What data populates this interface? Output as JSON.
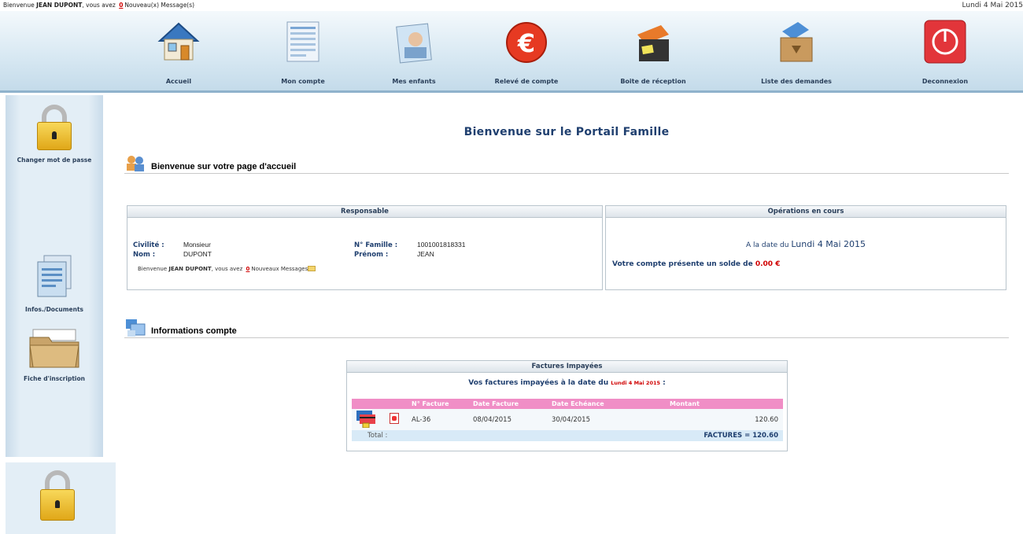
{
  "header": {
    "greeting_prefix": "Bienvenue",
    "user_name": "JEAN DUPONT",
    "greeting_mid": ", vous avez",
    "message_count": "0",
    "greeting_suffix": "Nouveau(x) Message(s)",
    "date": "Lundi 4 Mai 2015"
  },
  "nav": {
    "items": [
      {
        "label": "Accueil",
        "icon": "house-icon"
      },
      {
        "label": "Mon compte",
        "icon": "account-document-icon"
      },
      {
        "label": "Mes enfants",
        "icon": "children-photo-icon"
      },
      {
        "label": "Relevé de compte",
        "icon": "euro-icon"
      },
      {
        "label": "Boite de réception",
        "icon": "inbox-icon"
      },
      {
        "label": "Liste des demandes",
        "icon": "requests-box-icon"
      },
      {
        "label": "Deconnexion",
        "icon": "power-icon"
      }
    ]
  },
  "sidebar": {
    "items": [
      {
        "label": "Changer mot de passe",
        "icon": "lock-icon"
      },
      {
        "label": "Infos./Documents",
        "icon": "documents-icon"
      },
      {
        "label": "Fiche d'inscription",
        "icon": "folder-icon"
      }
    ]
  },
  "main": {
    "title": "Bienvenue sur le Portail Famille",
    "welcome_section": "Bienvenue sur votre page d'accueil",
    "account_section": "Informations compte"
  },
  "responsable": {
    "title": "Responsable",
    "civilite_label": "Civilité :",
    "civilite_value": "Monsieur",
    "nom_label": "Nom :",
    "nom_value": "DUPONT",
    "famille_label": "N° Famille :",
    "famille_value": "1001001818331",
    "prenom_label": "Prénom :",
    "prenom_value": "JEAN",
    "greet_prefix": "Bienvenue",
    "greet_name": "JEAN DUPONT",
    "greet_mid": ", vous avez",
    "greet_count": "0",
    "greet_suffix": "Nouveaux Messages"
  },
  "operations": {
    "title": "Opérations en cours",
    "date_prefix": "A la date du",
    "date_value": "Lundi 4 Mai 2015",
    "solde_prefix": "Votre compte présente un solde de",
    "solde_value": "0.00 €"
  },
  "factures": {
    "title": "Factures Impayées",
    "subtitle_prefix": "Vos factures impayées à la date du",
    "subtitle_date": "Lundi 4 Mai 2015",
    "subtitle_suffix": ":",
    "columns": [
      "N° Facture",
      "Date Facture",
      "Date Echéance",
      "Montant"
    ],
    "rows": [
      {
        "numero": "AL-36",
        "date_facture": "08/04/2015",
        "date_echeance": "30/04/2015",
        "montant": "120.60"
      }
    ],
    "total_label": "Total :",
    "total_value": "FACTURES = 120.60"
  },
  "colors": {
    "accent": "#1f3f6f",
    "alert": "#d00000",
    "table_header": "#f08ec6"
  }
}
